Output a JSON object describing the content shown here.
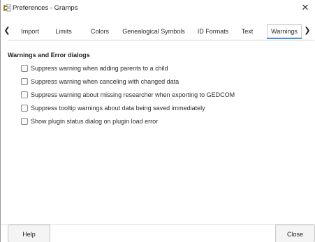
{
  "window": {
    "title": "Preferences - Gramps",
    "close_glyph": "✕",
    "icon": "gramps-tree-icon"
  },
  "tabs": {
    "scroll_left_glyph": "❮",
    "scroll_right_glyph": "❯",
    "items": [
      {
        "label": "Import",
        "active": false
      },
      {
        "label": "Limits",
        "active": false
      },
      {
        "label": "Colors",
        "active": false
      },
      {
        "label": "Genealogical Symbols",
        "active": false
      },
      {
        "label": "ID Formats",
        "active": false
      },
      {
        "label": "Text",
        "active": false
      },
      {
        "label": "Warnings",
        "active": true
      }
    ],
    "accent_color": "#4a90d9"
  },
  "warnings": {
    "section_title": "Warnings and Error dialogs",
    "options": [
      {
        "label": "Suppress warning when adding parents to a child",
        "checked": false
      },
      {
        "label": "Suppress warning when canceling with changed data",
        "checked": false
      },
      {
        "label": "Suppress warning about missing researcher when exporting to GEDCOM",
        "checked": false
      },
      {
        "label": "Suppress tooltip warnings about data being saved immediately",
        "checked": false
      },
      {
        "label": "Show plugin status dialog on plugin load error",
        "checked": false
      }
    ]
  },
  "footer": {
    "help_label": "Help",
    "close_label": "Close"
  }
}
